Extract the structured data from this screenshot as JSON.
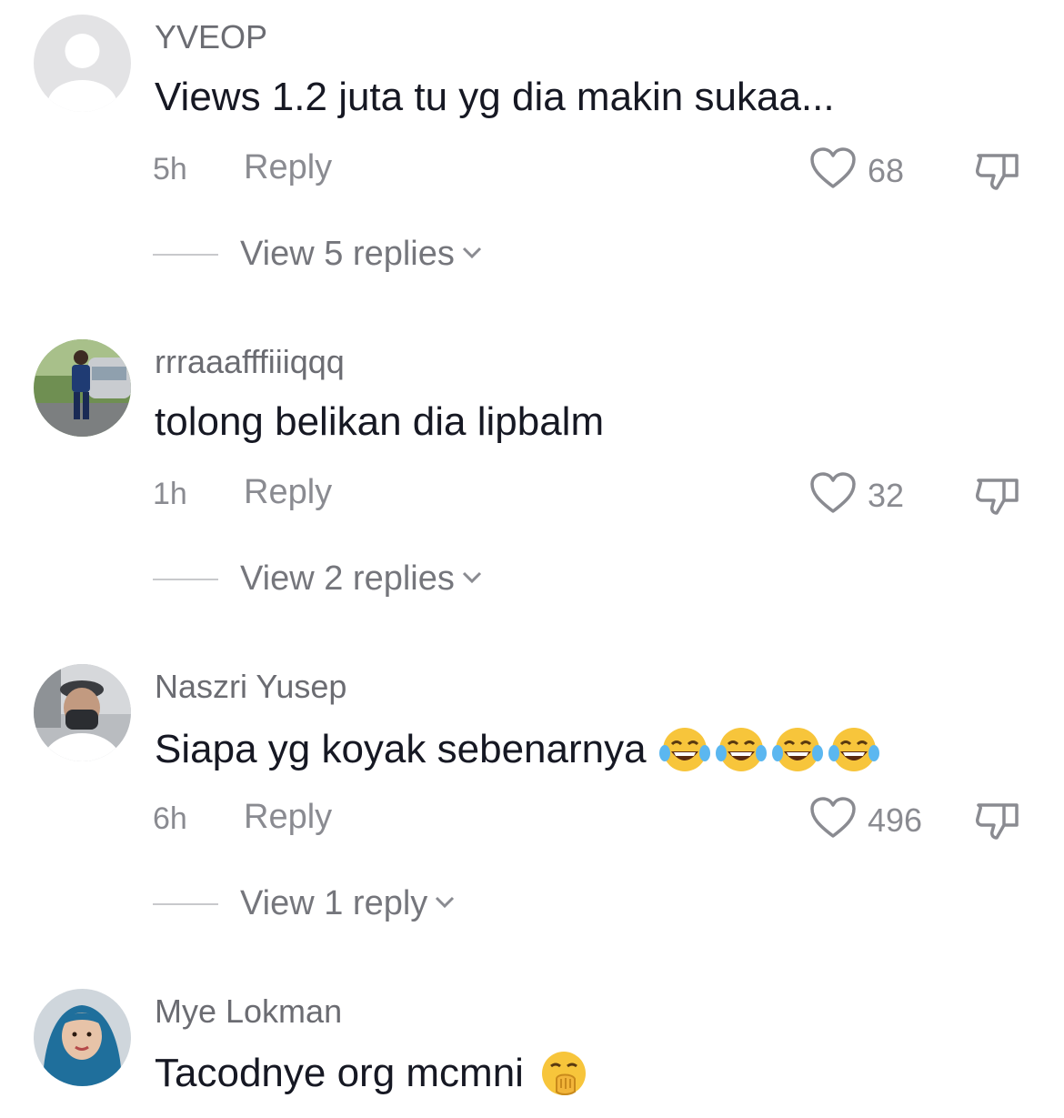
{
  "comments": [
    {
      "username": "YVEOP",
      "text": "Views 1.2 juta tu yg dia makin sukaa...",
      "time": "5h",
      "reply_label": "Reply",
      "likes": "68",
      "view_replies": "View 5 replies",
      "avatar": "default-avatar"
    },
    {
      "username": "rrraaafffiiiqqq",
      "text": "tolong belikan dia lipbalm",
      "time": "1h",
      "reply_label": "Reply",
      "likes": "32",
      "view_replies": "View 2 replies",
      "avatar": "photo-avatar"
    },
    {
      "username": "Naszri Yusep",
      "text": "Siapa yg koyak sebenarnya",
      "emojis": [
        "face-with-tears-of-joy",
        "face-with-tears-of-joy",
        "face-with-tears-of-joy",
        "face-with-tears-of-joy"
      ],
      "time": "6h",
      "reply_label": "Reply",
      "likes": "496",
      "view_replies": "View 1 reply",
      "avatar": "photo-avatar"
    },
    {
      "username": "Mye Lokman",
      "text": "Tacodnye org mcmni",
      "emojis": [
        "face-with-hand-over-mouth"
      ],
      "avatar": "photo-avatar"
    }
  ],
  "colors": {
    "primary_text": "#161823",
    "secondary_text": "#8a8b91",
    "username": "#6b6c72",
    "emoji_yellow": "#f7c53b"
  },
  "icons": [
    "heart-icon",
    "thumbs-down-icon",
    "chevron-down-icon"
  ]
}
